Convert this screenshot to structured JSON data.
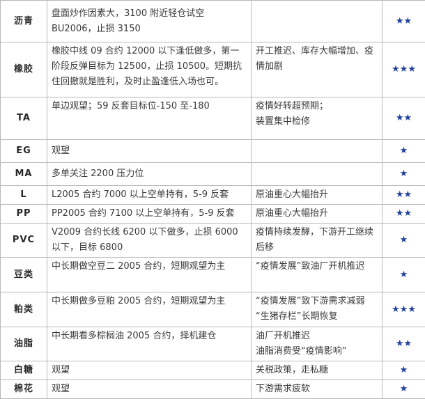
{
  "rows": [
    {
      "name": "沥青",
      "view": "盘面炒作因素大，3100 附近轻仓试空 BU2006，止损 3150",
      "reason": [],
      "stars": "★★"
    },
    {
      "name": "橡胶",
      "view": "橡胶中线 09 合约 12000 以下逢低做多，第一阶段反弹目标为 12500，止损 10500。短期抗住回撤就是胜利，及时止盈逢低入场也可。",
      "reason": [
        "开工推迟、库存大幅增加、疫情加剧"
      ],
      "stars": "★★★"
    },
    {
      "name": "TA",
      "view": "单边观望；59 反套目标位-150 至-180",
      "reason": [
        "疫情好转超预期；",
        "装置集中检修"
      ],
      "stars": "★★"
    },
    {
      "name": "EG",
      "view": "观望",
      "reason": [],
      "stars": "★"
    },
    {
      "name": "MA",
      "view": "多单关注 2200 压力位",
      "reason": [],
      "stars": "★"
    },
    {
      "name": "L",
      "view": "L2005 合约 7000 以上空单持有，5-9 反套",
      "reason": [
        "原油重心大幅抬升"
      ],
      "stars": "★★"
    },
    {
      "name": "PP",
      "view": "PP2005 合约 7100 以上空单持有，5-9 反套",
      "reason": [
        "原油重心大幅抬升"
      ],
      "stars": "★★"
    },
    {
      "name": "PVC",
      "view": "V2009 合约长线 6200 以下做多，止损 6000 以下，目标 6800",
      "reason": [
        "疫情持续发酵，下游开工继续后移"
      ],
      "stars": "★"
    },
    {
      "name": "豆类",
      "view": "中长期做空豆二 2005 合约，短期观望为主",
      "reason": [
        "“疫情发展”致油厂开机推迟"
      ],
      "stars": "★"
    },
    {
      "name": "粕类",
      "view": "中长期做多豆粕 2005 合约，短期观望为主",
      "reason": [
        "“疫情发展”致下游需求减弱",
        "“生猪存栏”长期恢复"
      ],
      "stars": "★★★"
    },
    {
      "name": "油脂",
      "view": "中长期看多棕榈油 2005 合约，择机建仓",
      "reason": [
        "油厂开机推迟",
        "油脂消费受“疫情影响”"
      ],
      "stars": "★★"
    },
    {
      "name": "白糖",
      "view": "观望",
      "reason": [
        "关税政策，走私糖"
      ],
      "stars": "★"
    },
    {
      "name": "棉花",
      "view": "观望",
      "reason": [
        "下游需求疲软"
      ],
      "stars": "★"
    }
  ]
}
